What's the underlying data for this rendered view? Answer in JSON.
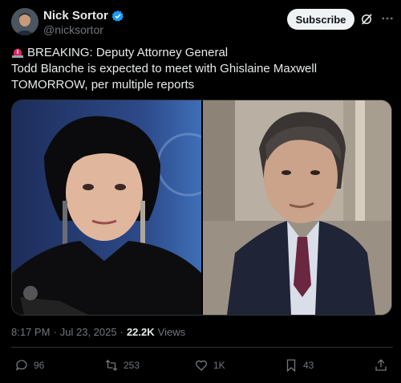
{
  "author": {
    "name": "Nick Sortor",
    "handle": "@nicksortor"
  },
  "header": {
    "subscribe_label": "Subscribe"
  },
  "tweet": {
    "line1": "BREAKING: Deputy Attorney General",
    "line2": "Todd Blanche is expected to meet with Ghislaine Maxwell TOMORROW, per multiple reports"
  },
  "meta": {
    "time": "8:17 PM",
    "dot": "·",
    "date": "Jul 23, 2025",
    "views_count": "22.2K",
    "views_label": "Views"
  },
  "actions": {
    "replies": "96",
    "reposts": "253",
    "likes": "1K",
    "bookmarks": "43"
  },
  "colors": {
    "background": "#000000",
    "text": "#e7e9ea",
    "muted": "#71767b",
    "verified": "#1d9bf0",
    "siren": "#e0245e"
  },
  "icons": [
    "verified-icon",
    "grok-icon",
    "more-icon",
    "siren-icon",
    "reply-icon",
    "repost-icon",
    "like-icon",
    "bookmark-icon",
    "share-icon"
  ]
}
